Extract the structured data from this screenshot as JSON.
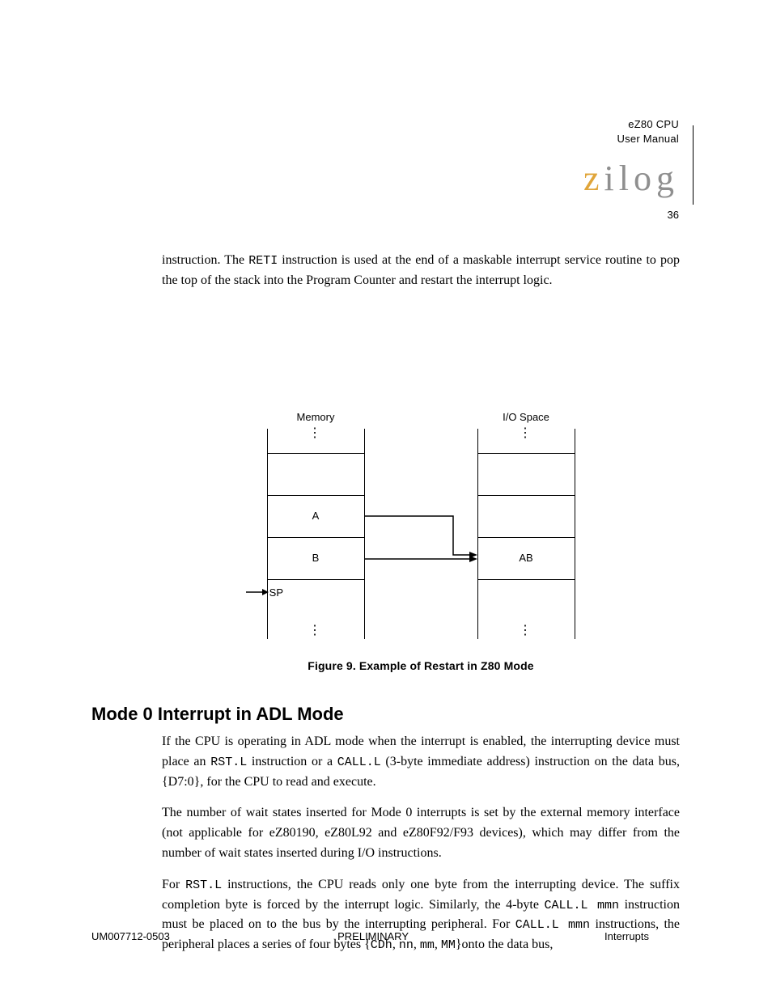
{
  "header": {
    "line1": "eZ80 CPU",
    "line2": "User Manual"
  },
  "logo": {
    "z": "z",
    "rest": "ilog"
  },
  "page_number": "36",
  "intro_para": "instruction. The RETI instruction is used at the end of a maskable interrupt service routine to pop the top of the stack into the Program Counter and restart the interrupt logic.",
  "figure": {
    "left_title": "Memory",
    "right_title": "I/O Space",
    "left_cells": {
      "r2": "",
      "r3": "A",
      "r4": "B",
      "r5": ""
    },
    "right_cells": {
      "r2": "",
      "r3": "",
      "r4": "AB",
      "r5": ""
    },
    "sp_left": "SP",
    "caption": "Figure 9. Example of Restart in Z80 Mode"
  },
  "section": {
    "title": "Mode 0 Interrupt in ADL Mode",
    "paragraphs": [
      "If the CPU is operating in ADL mode when the interrupt is enabled, the interrupting device must place an RST.L instruction or a CALL.L (3-byte immediate address) instruction on the data bus, {D7:0}, for the CPU to read and execute.",
      "The number of wait states inserted for Mode 0 interrupts is set by the external memory interface (not applicable for eZ80190, eZ80L92 and eZ80F92/F93 devices), which may differ from the number of wait states inserted during I/O instructions.",
      "For RST.L instructions, the CPU reads only one byte from the interrupting device. The suffix completion byte is forced by the interrupt logic. Similarly, the 4-byte CALL.L mmn instruction must be placed on to the bus by the interrupting peripheral. For CALL.L mmn instructions, the peripheral places a series of four bytes {CDh, nn, mm, MM}onto the data bus,"
    ]
  },
  "footer": {
    "doc_id": "UM007712-0503",
    "doc_label": "PRELIMINARY",
    "right": "Interrupts"
  }
}
